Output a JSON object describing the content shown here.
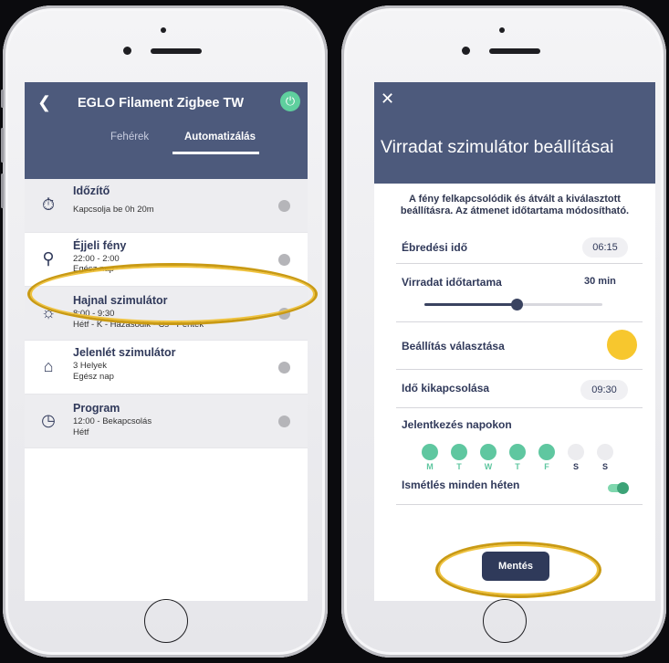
{
  "left_screen": {
    "title": "EGLO Filament Zigbee TW",
    "tabs": [
      "Fehérek",
      "Automatizálás"
    ],
    "items": [
      {
        "title": "Időzítő",
        "lines": [
          "Kapcsolja be 0h 20m"
        ],
        "icon": "timer-icon"
      },
      {
        "title": "Éjjeli fény",
        "lines": [
          "22:00 - 2:00",
          "Egész nap"
        ],
        "icon": "night-light-icon"
      },
      {
        "title": "Hajnal szimulátor",
        "lines": [
          "8:00 - 9:30",
          "Hétf - K - Házasodik - Cs - Péntek"
        ],
        "icon": "sunrise-icon"
      },
      {
        "title": "Jelenlét szimulátor",
        "lines": [
          "3 Helyek",
          "Egész nap"
        ],
        "icon": "house-icon"
      },
      {
        "title": "Program",
        "lines": [
          "12:00 - Bekapcsolás",
          "Hétf"
        ],
        "icon": "clock-icon"
      }
    ]
  },
  "right_screen": {
    "title": "Virradat szimulátor beállításai",
    "intro_line1": "A fény felkapcsolódik és átvált a kiválasztott",
    "intro_line2": "beállításra. Az átmenet időtartama módosítható.",
    "wake_label": "Ébredési idő",
    "wake_value": "06:15",
    "duration_label": "Virradat időtartama",
    "duration_value": "30 min",
    "duration_fraction": 0.52,
    "setting_label": "Beállítás választása",
    "setting_color": "#f7c72e",
    "off_label": "Idő kikapcsolása",
    "off_value": "09:30",
    "days_label": "Jelentkezés napokon",
    "days": [
      {
        "letter": "M",
        "active": true
      },
      {
        "letter": "T",
        "active": true
      },
      {
        "letter": "W",
        "active": true
      },
      {
        "letter": "T",
        "active": true
      },
      {
        "letter": "F",
        "active": true
      },
      {
        "letter": "S",
        "active": false
      },
      {
        "letter": "S",
        "active": false
      }
    ],
    "repeat_label": "Ismétlés minden héten",
    "repeat_on": true,
    "save_label": "Mentés"
  },
  "colors": {
    "header": "#4d5a7c",
    "accent_green": "#5fcf9e",
    "highlight_gold": "#c99a14"
  }
}
